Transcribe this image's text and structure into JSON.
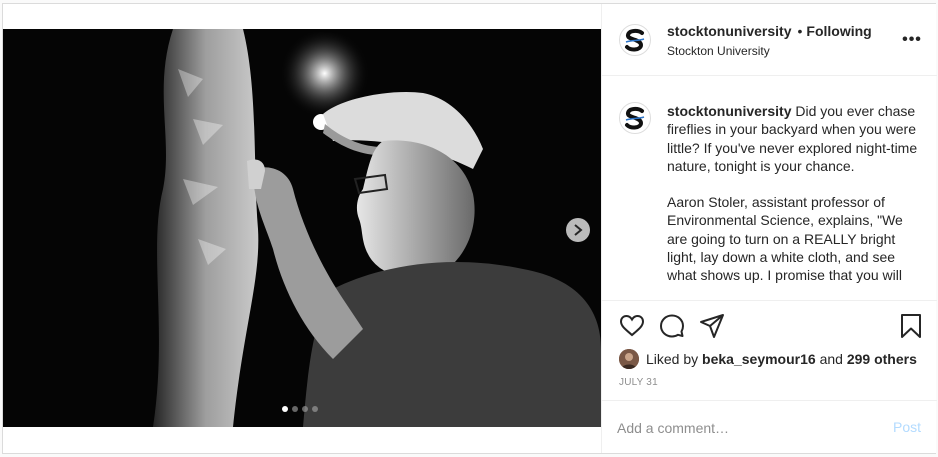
{
  "post": {
    "author": "stocktonuniversity",
    "separator": "•",
    "follow_status": "Following",
    "location": "Stockton University",
    "more_label": "•••"
  },
  "caption": {
    "username": "stocktonuniversity",
    "paragraph1": "Did you ever chase fireflies in your backyard when you were little? If you've never explored night-time nature, tonight is your chance.",
    "paragraph2": "Aaron Stoler, assistant professor of Environmental Science, explains, \"We are going to turn on a REALLY bright light, lay down a white cloth, and see what shows up. I promise that you will"
  },
  "media": {
    "carousel_count": 4,
    "carousel_active": 1
  },
  "likes": {
    "prefix": "Liked by",
    "user": "beka_seymour16",
    "middle": "and",
    "others": "299 others"
  },
  "date": "JULY 31",
  "comment": {
    "placeholder": "Add a comment…",
    "post_label": "Post"
  },
  "icons": {
    "like": "heart-icon",
    "comment": "comment-icon",
    "share": "share-icon",
    "save": "bookmark-icon",
    "next": "chevron-right-icon"
  },
  "colors": {
    "post_button": "#b3dbff",
    "muted": "#8e8e8e",
    "text": "#262626"
  }
}
